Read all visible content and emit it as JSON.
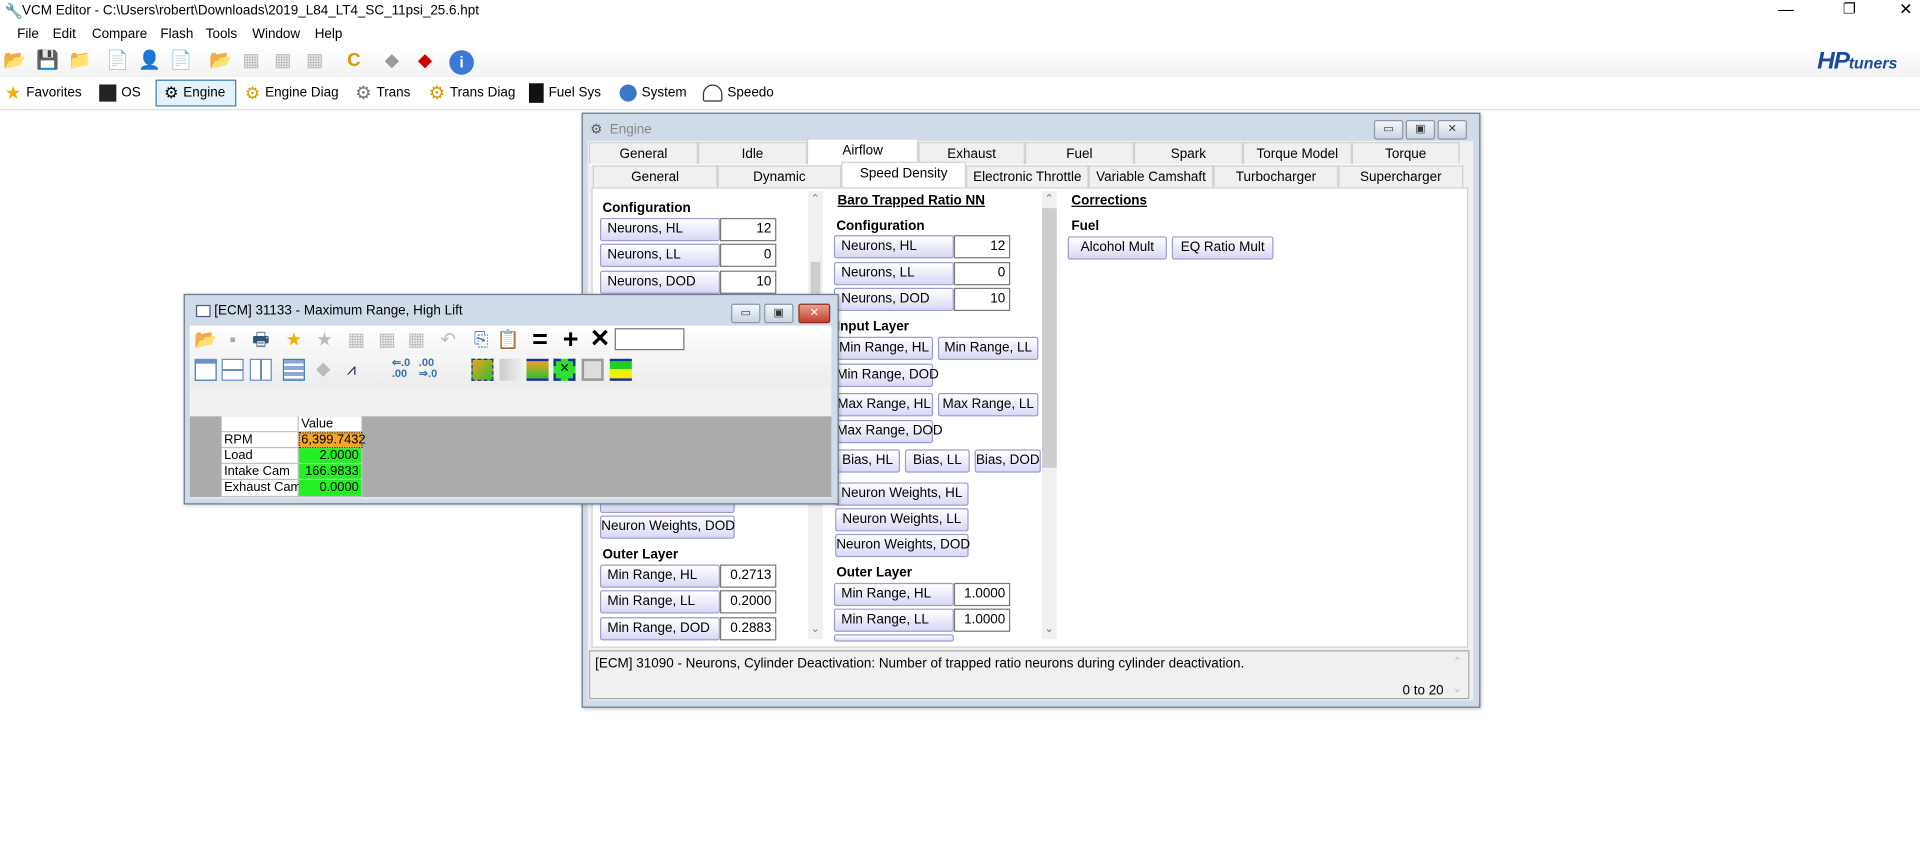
{
  "app": {
    "title": "VCM Editor - C:\\Users\\robert\\Downloads\\2019_L84_LT4_SC_11psi_25.6.hpt",
    "window_controls": [
      "minimize",
      "maximize",
      "close"
    ]
  },
  "menu": [
    "File",
    "Edit",
    "Compare",
    "Flash",
    "Tools",
    "Window",
    "Help"
  ],
  "toolbar_icons": [
    "open-file-icon",
    "save-icon",
    "open-recent-icon",
    "file-info-icon",
    "user-info-icon",
    "file-history-icon",
    "new-file-icon",
    "table-icon",
    "table-icon",
    "table-icon",
    "checksum-icon",
    "chip-icon",
    "write-chip-icon",
    "info-icon"
  ],
  "brand": {
    "logo": "HPtuners",
    "hp": "HP",
    "tuners": "tuners",
    "color": "#1b4a9c"
  },
  "nav": [
    {
      "label": "Favorites",
      "icon": "star-icon"
    },
    {
      "label": "OS",
      "icon": "chip-icon"
    },
    {
      "label": "Engine",
      "icon": "engine-icon",
      "selected": true
    },
    {
      "label": "Engine Diag",
      "icon": "engine-diag-icon"
    },
    {
      "label": "Trans",
      "icon": "gear-icon"
    },
    {
      "label": "Trans Diag",
      "icon": "gear-diag-icon"
    },
    {
      "label": "Fuel Sys",
      "icon": "fuel-pump-icon"
    },
    {
      "label": "System",
      "icon": "fan-icon"
    },
    {
      "label": "Speedo",
      "icon": "speedometer-icon"
    }
  ],
  "engine": {
    "title": "Engine",
    "tabs1": [
      "General",
      "Idle",
      "Airflow",
      "Exhaust",
      "Fuel",
      "Spark",
      "Torque Model",
      "Torque Managemen"
    ],
    "tabs1_selected": "Airflow",
    "tabs2": [
      "General",
      "Dynamic",
      "Speed Density",
      "Electronic Throttle",
      "Variable Camshaft",
      "Turbocharger",
      "Supercharger"
    ],
    "tabs2_selected": "Speed Density",
    "col1": {
      "config_heading": "Configuration",
      "config": [
        {
          "label": "Neurons, HL",
          "value": "12"
        },
        {
          "label": "Neurons, LL",
          "value": "0"
        },
        {
          "label": "Neurons, DOD",
          "value": "10"
        }
      ],
      "nw_dod": "Neuron Weights, DOD",
      "outer_heading": "Outer Layer",
      "outer": [
        {
          "label": "Min Range, HL",
          "value": "0.2713"
        },
        {
          "label": "Min Range, LL",
          "value": "0.2000"
        },
        {
          "label": "Min Range, DOD",
          "value": "0.2883"
        }
      ]
    },
    "col2": {
      "title": "Baro Trapped Ratio NN",
      "config_heading": "Configuration",
      "config": [
        {
          "label": "Neurons, HL",
          "value": "12"
        },
        {
          "label": "Neurons, LL",
          "value": "0"
        },
        {
          "label": "Neurons, DOD",
          "value": "10"
        }
      ],
      "input_heading": "Input Layer",
      "input_buttons": [
        "Min Range, HL",
        "Min Range, LL",
        "Min Range, DOD",
        "Max Range, HL",
        "Max Range, LL",
        "Max Range, DOD",
        "Bias, HL",
        "Bias, LL",
        "Bias, DOD",
        "Neuron Weights, HL",
        "Neuron Weights, LL",
        "Neuron Weights, DOD"
      ],
      "outer_heading": "Outer Layer",
      "outer": [
        {
          "label": "Min Range, HL",
          "value": "1.0000"
        },
        {
          "label": "Min Range, LL",
          "value": "1.0000"
        }
      ]
    },
    "col3": {
      "title": "Corrections",
      "fuel_heading": "Fuel",
      "buttons": [
        "Alcohol Mult",
        "EQ Ratio Mult"
      ]
    },
    "description": "[ECM] 31090 - Neurons, Cylinder Deactivation: Number of trapped ratio neurons during cylinder deactivation.",
    "range": "0 to 20"
  },
  "popup": {
    "title": "[ECM] 31133 - Maximum Range, High Lift",
    "input_value": "",
    "table": {
      "header": "Value",
      "rows": [
        {
          "label": "RPM",
          "value": "6,399.7432",
          "color": "#f5a623"
        },
        {
          "label": "Load",
          "value": "2.0000",
          "color": "#22f022"
        },
        {
          "label": "Intake Cam",
          "value": "166.9833",
          "color": "#22f022"
        },
        {
          "label": "Exhaust Cam",
          "value": "0.0000",
          "color": "#22f022"
        }
      ]
    }
  }
}
